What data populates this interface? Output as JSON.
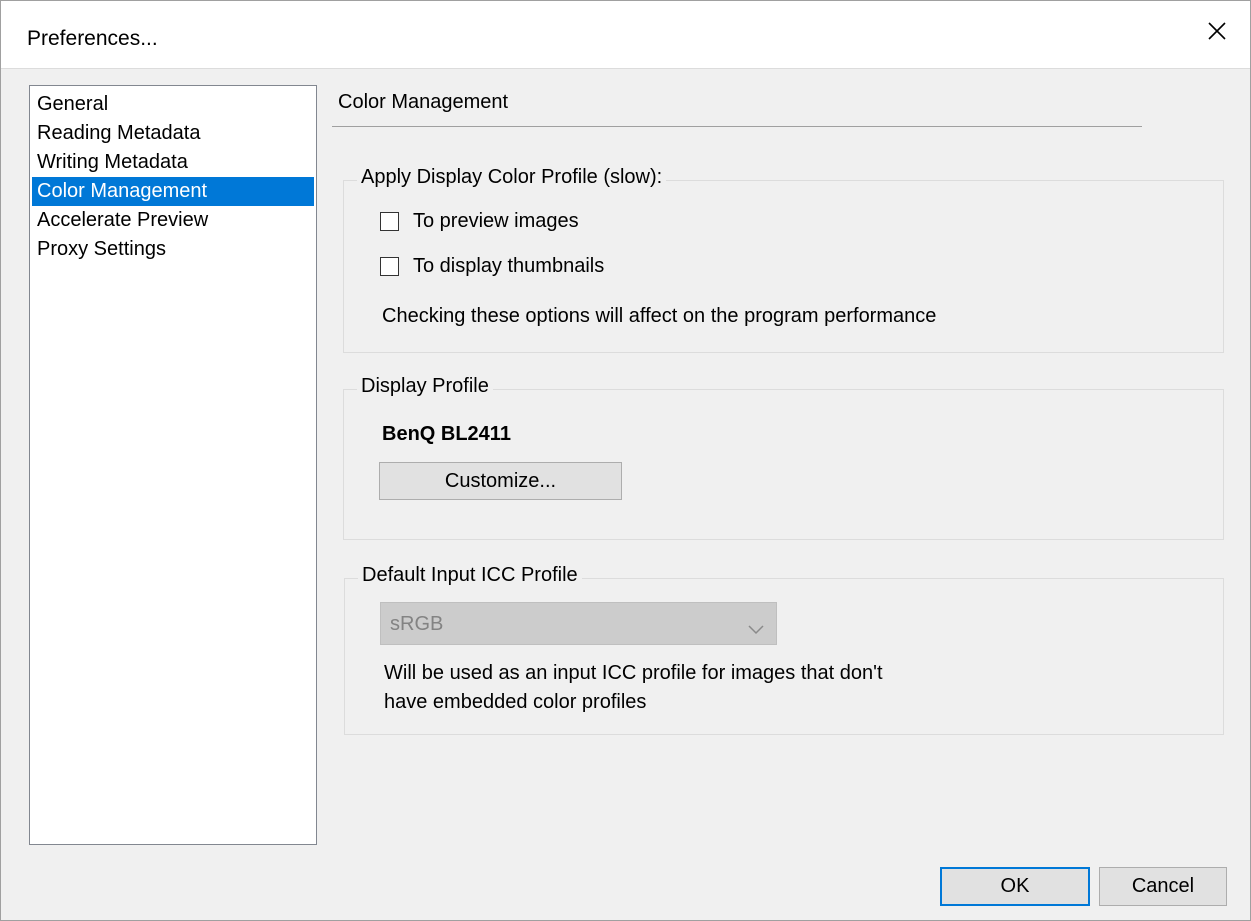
{
  "window": {
    "title": "Preferences..."
  },
  "nav": {
    "items": [
      {
        "label": "General",
        "selected": false
      },
      {
        "label": "Reading Metadata",
        "selected": false
      },
      {
        "label": "Writing Metadata",
        "selected": false
      },
      {
        "label": "Color Management",
        "selected": true
      },
      {
        "label": "Accelerate Preview",
        "selected": false
      },
      {
        "label": "Proxy Settings",
        "selected": false
      }
    ]
  },
  "page": {
    "heading": "Color Management"
  },
  "apply_group": {
    "legend": "Apply Display Color Profile (slow):",
    "preview_label": "To preview images",
    "preview_checked": false,
    "thumbnails_label": "To display thumbnails",
    "thumbnails_checked": false,
    "note": "Checking these options will affect on the program performance"
  },
  "display_group": {
    "legend": "Display Profile",
    "profile_name": "BenQ BL2411",
    "customize_label": "Customize..."
  },
  "input_group": {
    "legend": "Default Input ICC Profile",
    "selected_value": "sRGB",
    "disabled": true,
    "note_line1": "Will be used as an input ICC profile for images that don't",
    "note_line2": "have embedded color profiles"
  },
  "footer": {
    "ok_label": "OK",
    "cancel_label": "Cancel"
  },
  "colors": {
    "selection": "#0078d7",
    "background": "#f0f0f0"
  },
  "icons": {
    "close": "close-icon",
    "dropdown": "chevron-down-icon"
  }
}
